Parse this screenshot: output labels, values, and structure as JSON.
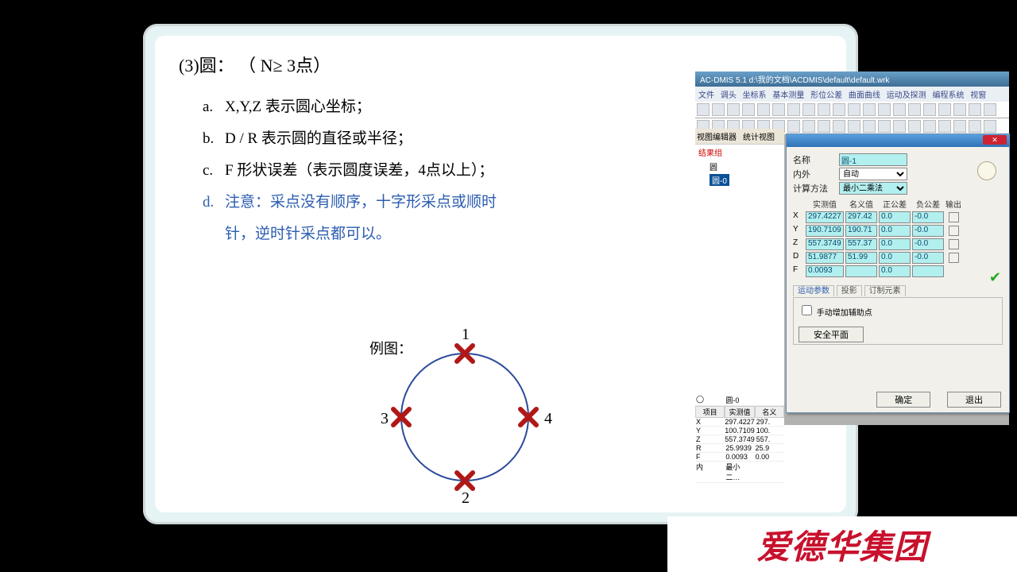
{
  "slide": {
    "title": "(3)圆：  （ N≥ 3点）",
    "items": {
      "a": {
        "lab": "a.",
        "txt": "X,Y,Z 表示圆心坐标；"
      },
      "b": {
        "lab": "b.",
        "txt": "D / R 表示圆的直径或半径；"
      },
      "c": {
        "lab": "c.",
        "txt": "F 形状误差（表示圆度误差，4点以上）；"
      },
      "d": {
        "lab": "d.",
        "txt1": "注意：采点没有顺序，十字形采点或顺时",
        "txt2": "针，逆时针采点都可以。"
      }
    },
    "example_label": "例图：",
    "points": {
      "p1": "1",
      "p2": "2",
      "p3": "3",
      "p4": "4"
    }
  },
  "app": {
    "titlebar": "AC-DMIS 5.1    d:\\我的文档\\ACDMIS\\default\\default.wrk",
    "menus": [
      "文件",
      "调头",
      "坐标系",
      "基本测量",
      "形位公差",
      "曲面曲线",
      "运动及探测",
      "编程系统",
      "视窗"
    ],
    "tree": {
      "tabs": [
        "视图编辑器",
        "统计视图"
      ],
      "root": "结果组",
      "n1": "圆",
      "n2": "圆-0"
    },
    "bottom": {
      "circ_label": "圆-0",
      "headers": [
        "项目",
        "实测值",
        "名义"
      ],
      "rows": [
        [
          "X",
          "297.4227",
          "297."
        ],
        [
          "Y",
          "100.7109",
          "100."
        ],
        [
          "Z",
          "557.3749",
          "557."
        ],
        [
          "R",
          "25.9939",
          "25.9"
        ],
        [
          "F",
          "0.0093",
          "0.00"
        ]
      ],
      "foot1": "内",
      "foot2": "最小二…"
    }
  },
  "dlg": {
    "name_label": "名称",
    "name_val": "圆-1",
    "io_label": "内外",
    "io_val": "自动",
    "calc_label": "计算方法",
    "calc_val": "最小二乘法",
    "cols": [
      "实测值",
      "名义值",
      "正公差",
      "负公差",
      "输出"
    ],
    "rows": [
      {
        "k": "X",
        "m": "297.4227",
        "n": "297.42",
        "p": "0.0",
        "q": "-0.0"
      },
      {
        "k": "Y",
        "m": "190.7109",
        "n": "190.71",
        "p": "0.0",
        "q": "-0.0"
      },
      {
        "k": "Z",
        "m": "557.3749",
        "n": "557.37",
        "p": "0.0",
        "q": "-0.0"
      },
      {
        "k": "D",
        "m": "51.9877",
        "n": "51.99",
        "p": "0.0",
        "q": "-0.0"
      },
      {
        "k": "F",
        "m": "0.0093",
        "n": "",
        "p": "0.0",
        "q": ""
      }
    ],
    "tabs": [
      "运动参数",
      "投影",
      "订制元素"
    ],
    "aux_chk": "手动增加辅助点",
    "btn_plane": "安全平面",
    "btn_ok": "确定",
    "btn_exit": "退出"
  },
  "brand": "爱德华集团"
}
